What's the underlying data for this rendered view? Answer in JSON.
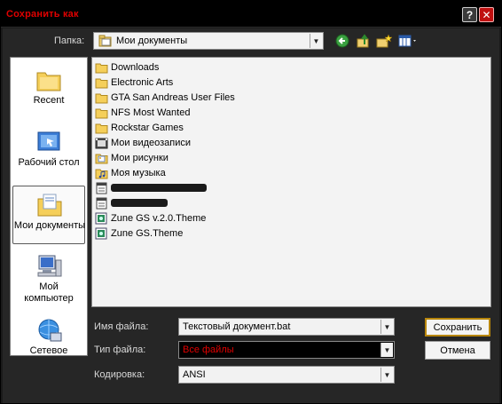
{
  "window": {
    "title": "Сохранить как",
    "help_label": "?",
    "close_label": "✕"
  },
  "toolbar": {
    "lookin_label": "Папка:",
    "lookin_value": "Мои документы"
  },
  "places": [
    {
      "label": "Recent"
    },
    {
      "label": "Рабочий стол"
    },
    {
      "label": "Мои документы"
    },
    {
      "label_line1": "Мой",
      "label_line2": "компьютер"
    },
    {
      "label": "Сетевое"
    }
  ],
  "files": [
    {
      "name": "Downloads",
      "icon": "folder-icon"
    },
    {
      "name": "Electronic Arts",
      "icon": "folder-icon"
    },
    {
      "name": "GTA San Andreas User Files",
      "icon": "folder-icon"
    },
    {
      "name": "NFS Most Wanted",
      "icon": "folder-icon"
    },
    {
      "name": "Rockstar Games",
      "icon": "folder-icon"
    },
    {
      "name": "Мои видеозаписи",
      "icon": "video-folder-icon"
    },
    {
      "name": "Мои рисунки",
      "icon": "pictures-folder-icon"
    },
    {
      "name": "Моя музыка",
      "icon": "music-folder-icon"
    },
    {
      "name": "",
      "icon": "document-icon",
      "redacted": true
    },
    {
      "name": "",
      "icon": "document-icon",
      "redacted": true
    },
    {
      "name": "Zune GS v.2.0.Theme",
      "icon": "theme-file-icon"
    },
    {
      "name": "Zune GS.Theme",
      "icon": "theme-file-icon"
    }
  ],
  "form": {
    "filename_label": "Имя файла:",
    "filename_value": "Текстовый документ.bat",
    "filetype_label": "Тип файла:",
    "filetype_value": "Все файлы",
    "encoding_label": "Кодировка:",
    "encoding_value": "ANSI"
  },
  "buttons": {
    "save": "Сохранить",
    "cancel": "Отмена"
  },
  "colors": {
    "title_red": "#e00000",
    "window_dark": "#262626"
  }
}
